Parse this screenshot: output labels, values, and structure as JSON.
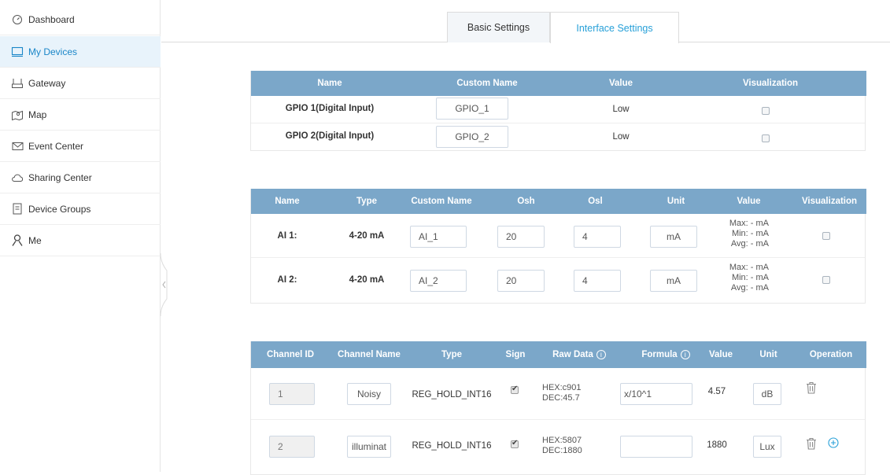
{
  "sidebar": {
    "items": [
      {
        "label": "Dashboard",
        "icon": "dashboard-icon"
      },
      {
        "label": "My Devices",
        "icon": "devices-icon"
      },
      {
        "label": "Gateway",
        "icon": "gateway-icon"
      },
      {
        "label": "Map",
        "icon": "map-icon"
      },
      {
        "label": "Event Center",
        "icon": "mail-icon"
      },
      {
        "label": "Sharing Center",
        "icon": "cloud-icon"
      },
      {
        "label": "Device Groups",
        "icon": "document-icon"
      },
      {
        "label": "Me",
        "icon": "user-icon"
      }
    ]
  },
  "tabs": {
    "basic": "Basic Settings",
    "interface": "Interface Settings"
  },
  "gpio": {
    "headers": [
      "Name",
      "Custom Name",
      "Value",
      "Visualization"
    ],
    "rows": [
      {
        "name": "GPIO 1(Digital Input)",
        "custom": "GPIO_1",
        "value": "Low"
      },
      {
        "name": "GPIO 2(Digital Input)",
        "custom": "GPIO_2",
        "value": "Low"
      }
    ]
  },
  "ai": {
    "headers": [
      "Name",
      "Type",
      "Custom Name",
      "Osh",
      "Osl",
      "Unit",
      "Value",
      "Visualization"
    ],
    "rows": [
      {
        "name": "AI 1:",
        "type": "4-20 mA",
        "custom": "AI_1",
        "osh": "20",
        "osl": "4",
        "unit": "mA",
        "max": "Max: - mA",
        "min": "Min: - mA",
        "avg": "Avg: - mA"
      },
      {
        "name": "AI 2:",
        "type": "4-20 mA",
        "custom": "AI_2",
        "osh": "20",
        "osl": "4",
        "unit": "mA",
        "max": "Max: - mA",
        "min": "Min: - mA",
        "avg": "Avg: - mA"
      }
    ]
  },
  "modbus": {
    "headers": [
      "Channel ID",
      "Channel Name",
      "Type",
      "Sign",
      "Raw Data",
      "Formula",
      "Value",
      "Unit",
      "Operation"
    ],
    "rows": [
      {
        "id": "1",
        "name": "Noisy",
        "type": "REG_HOLD_INT16",
        "hex": "HEX:c901",
        "dec": "DEC:45.7",
        "formula": "x/10^1",
        "value": "4.57",
        "unit": "dB"
      },
      {
        "id": "2",
        "name": "illuminat",
        "type": "REG_HOLD_INT16",
        "hex": "HEX:5807",
        "dec": "DEC:1880",
        "formula": "",
        "value": "1880",
        "unit": "Lux"
      }
    ]
  }
}
